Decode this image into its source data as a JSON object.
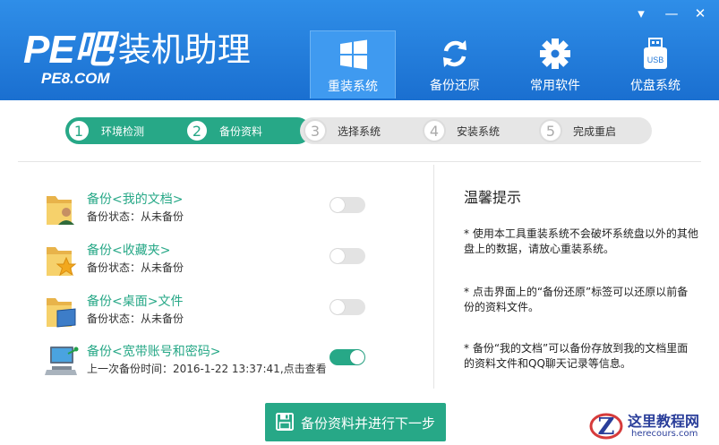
{
  "window": {
    "logo_main": "PE吧",
    "logo_cn": "装机助理",
    "logo_sub": "PE8.COM",
    "controls": [
      {
        "name": "menu",
        "glyph": "▾"
      },
      {
        "name": "minimize",
        "glyph": "—"
      },
      {
        "name": "close",
        "glyph": "✕"
      }
    ]
  },
  "nav": {
    "tabs": [
      {
        "label": "重装系统",
        "icon": "windows-icon",
        "active": true
      },
      {
        "label": "备份还原",
        "icon": "refresh-icon",
        "active": false
      },
      {
        "label": "常用软件",
        "icon": "gear-icon",
        "active": false
      },
      {
        "label": "优盘系统",
        "icon": "usb-drive-icon",
        "active": false
      }
    ],
    "usb_icon_text": "USB"
  },
  "steps": [
    {
      "num": "1",
      "label": "环境检测",
      "done": true
    },
    {
      "num": "2",
      "label": "备份资料",
      "done": true
    },
    {
      "num": "3",
      "label": "选择系统",
      "done": false
    },
    {
      "num": "4",
      "label": "安装系统",
      "done": false
    },
    {
      "num": "5",
      "label": "完成重启",
      "done": false
    }
  ],
  "backup_items": [
    {
      "title": "备份<我的文档>",
      "status": "备份状态：从未备份",
      "icon": "user-folder-icon",
      "enabled": false
    },
    {
      "title": "备份<收藏夹>",
      "status": "备份状态：从未备份",
      "icon": "favorites-folder-icon",
      "enabled": false
    },
    {
      "title": "备份<桌面>文件",
      "status": "备份状态：从未备份",
      "icon": "desktop-folder-icon",
      "enabled": false
    },
    {
      "title": "备份<宽带账号和密码>",
      "status": "上一次备份时间：2016-1-22 13:37:41,点击查看",
      "icon": "network-computer-icon",
      "enabled": true
    }
  ],
  "tips": {
    "title": "温馨提示",
    "items": [
      "* 使用本工具重装系统不会破坏系统盘以外的其他盘上的数据，请放心重装系统。",
      "* 点击界面上的“备份还原”标签可以还原以前备份的资料文件。",
      "* 备份“我的文档”可以备份存放到我的文档里面的资料文件和QQ聊天记录等信息。"
    ]
  },
  "primary_button": {
    "label": "备份资料并进行下一步",
    "icon": "floppy-disk-icon"
  },
  "watermark": {
    "cn": "这里教程网",
    "en": "herecours.com"
  },
  "colors": {
    "header_blue": "#1f7fdf",
    "accent_green": "#27a887",
    "toggle_off": "#e3e3e3",
    "watermark_navy": "#2a3e9a"
  }
}
